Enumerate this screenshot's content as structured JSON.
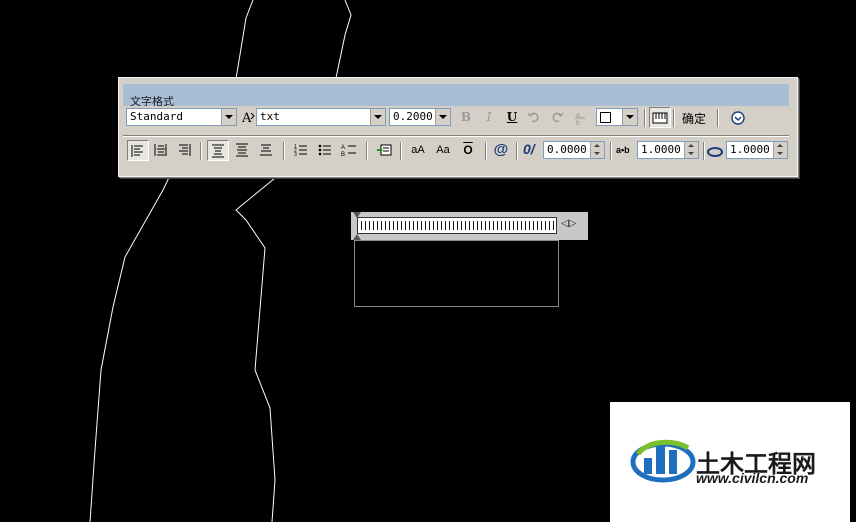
{
  "drawing": {
    "background": "#000000",
    "line_color": "#ffffff"
  },
  "toolbar": {
    "title": "文字格式",
    "style_value": "Standard",
    "font_value": "txt",
    "height_value": "0.2000",
    "bold": "B",
    "italic": "I",
    "underline": "U",
    "ok_label": "确定",
    "case_upper": "aA",
    "case_lower": "Aa",
    "overline": "O",
    "symbol": "@",
    "oblique_label": "0/",
    "oblique_value": "0.0000",
    "tracking_label": "a•b",
    "tracking_value": "1.0000",
    "width_value": "1.0000"
  },
  "ruler": {
    "arrows": "◁▷"
  },
  "watermark": {
    "name": "土木工程网",
    "url": "www.civilcn.com",
    "colors": [
      "#1f6fbf",
      "#7bbf2a"
    ]
  }
}
